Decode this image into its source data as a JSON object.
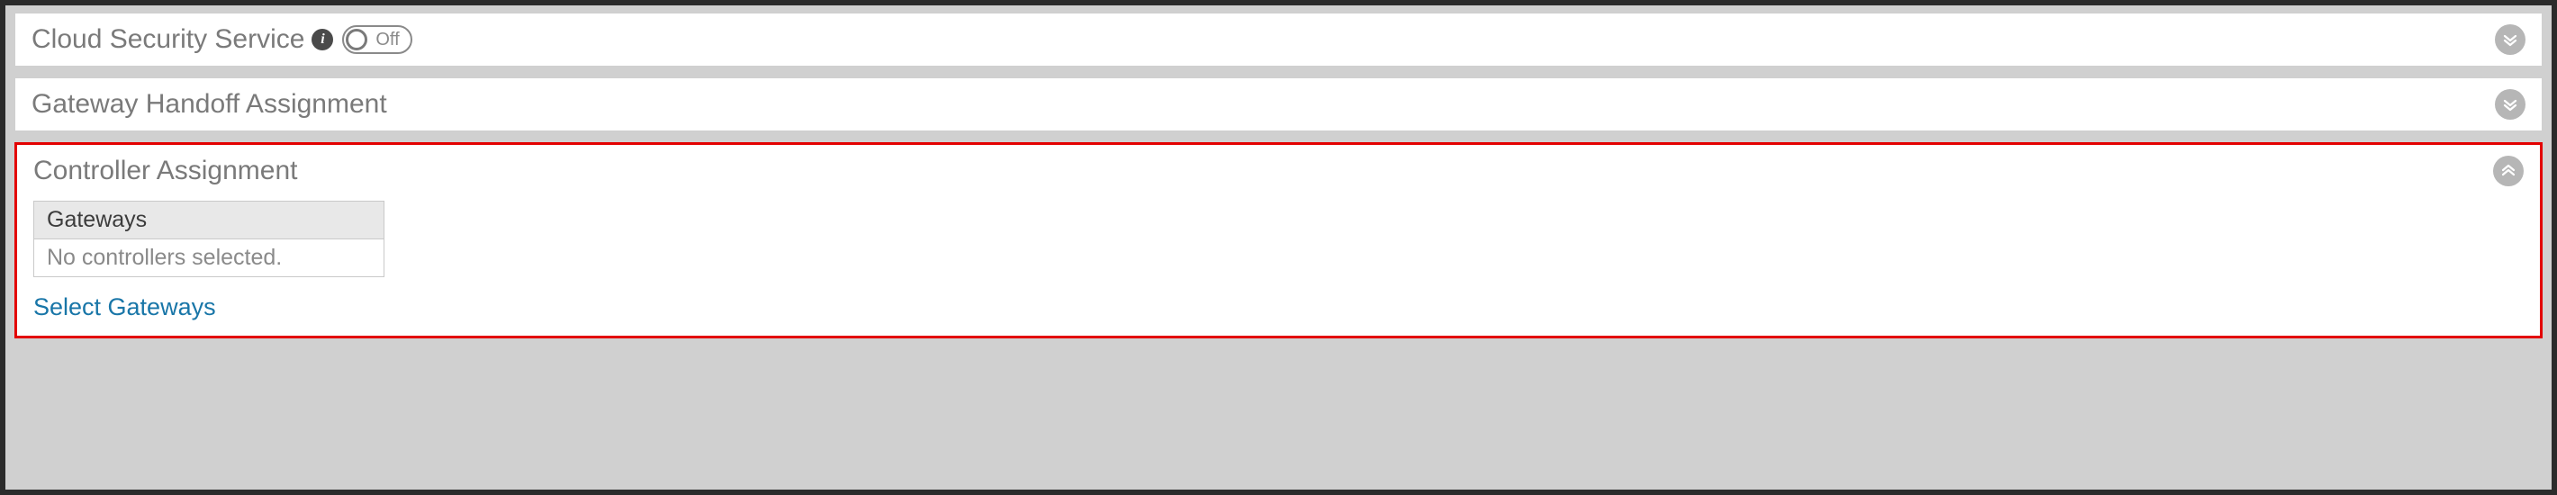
{
  "panels": {
    "cloud_security": {
      "title": "Cloud Security Service",
      "toggle_state": "Off",
      "expanded": false
    },
    "gateway_handoff": {
      "title": "Gateway Handoff Assignment",
      "expanded": false
    },
    "controller_assignment": {
      "title": "Controller Assignment",
      "expanded": true,
      "table_header": "Gateways",
      "table_empty_text": "No controllers selected.",
      "select_link": "Select Gateways",
      "highlighted": true
    }
  },
  "colors": {
    "highlight_border": "#e30000",
    "link": "#1976a8"
  }
}
